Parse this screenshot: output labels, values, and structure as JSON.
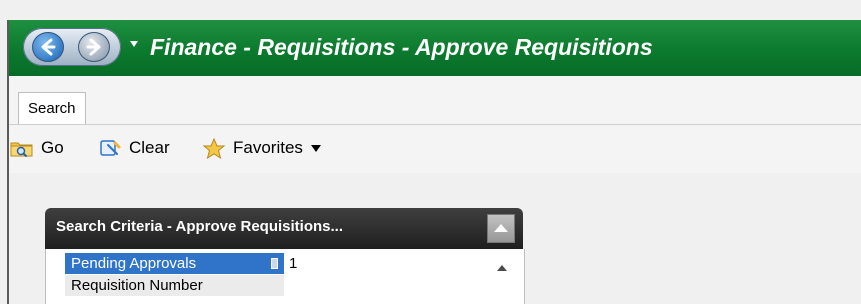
{
  "window": {
    "title": "Finance - Requisitions - Approve Requisitions",
    "nav": {
      "back_icon": "back-arrow-icon",
      "forward_icon": "forward-arrow-icon",
      "menu_icon": "dropdown-arrow-icon"
    },
    "accent": "#0b7a2e"
  },
  "tabs": [
    {
      "label": "Search"
    }
  ],
  "toolbar": {
    "go_label": "Go",
    "clear_label": "Clear",
    "favorites_label": "Favorites"
  },
  "search_panel": {
    "title": "Search Criteria - Approve Requisitions...",
    "rows": [
      {
        "label": "Pending Approvals",
        "value": "1"
      },
      {
        "label": "Requisition Number",
        "value": ""
      }
    ]
  }
}
